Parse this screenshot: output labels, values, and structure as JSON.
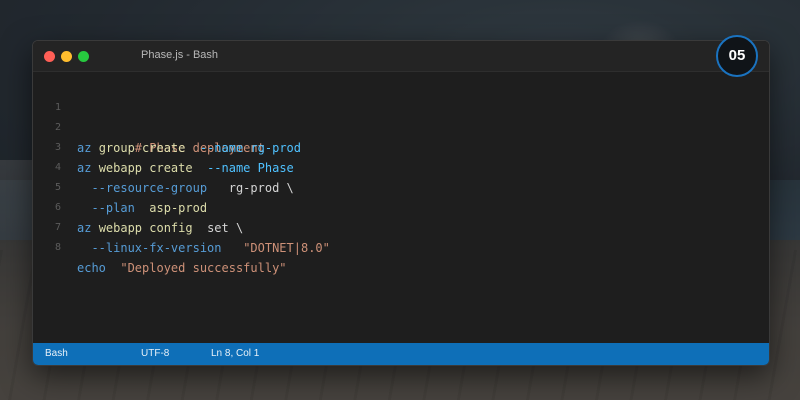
{
  "window": {
    "title": "Phase.js - Bash"
  },
  "badge": {
    "number": "05"
  },
  "code_lines": [
    {
      "num": "1",
      "tokens": [
        "# Phase deployment"
      ]
    },
    {
      "num": "2",
      "tokens": [
        "az",
        "group create",
        "--name",
        "rg-prod"
      ]
    },
    {
      "num": "3",
      "tokens": [
        "az",
        "webapp create",
        "--name",
        "Phase"
      ]
    },
    {
      "num": "4",
      "tokens": [
        "--resource-group",
        "rg-prod \\"
      ]
    },
    {
      "num": "5",
      "tokens": [
        "--plan",
        "asp-prod"
      ]
    },
    {
      "num": "6",
      "tokens": [
        "az",
        "webapp config",
        "set \\"
      ]
    },
    {
      "num": "7",
      "tokens": [
        "--linux-fx-version",
        "\"DOTNET|8.0\""
      ]
    },
    {
      "num": "8",
      "tokens": [
        "echo",
        "\"Deployed successfully\""
      ]
    }
  ],
  "statusbar": {
    "language": "Bash",
    "encoding": "UTF-8",
    "position": "Ln 8, Col 1"
  },
  "colors": {
    "statusbar": "#0e6fb8",
    "badge_ring": "#1a73c0",
    "keyword": "#569cd6",
    "subcommand": "#dcdcaa",
    "flag": "#4fc1ff",
    "string": "#ce9178"
  },
  "icons": {
    "close": "close-dot-icon",
    "minimize": "minimize-dot-icon",
    "maximize": "maximize-dot-icon"
  }
}
